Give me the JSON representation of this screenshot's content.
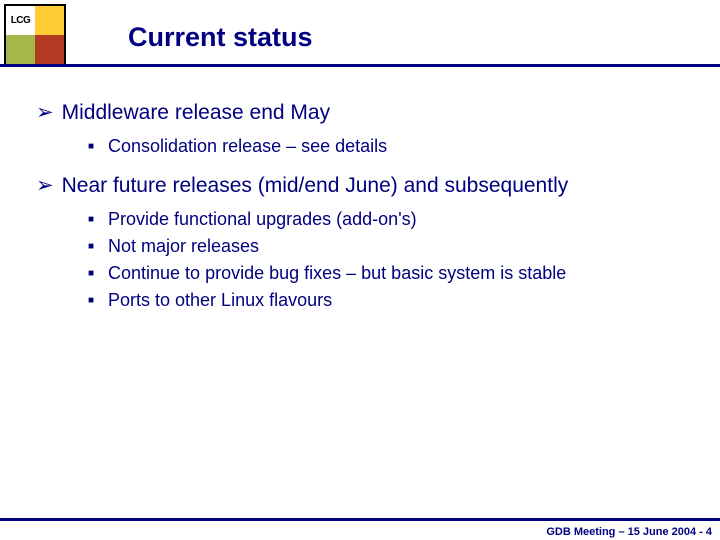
{
  "logo_text": "LCG",
  "title": "Current status",
  "bullets": [
    {
      "text": "Middleware release end May",
      "sub": [
        "Consolidation release – see details"
      ]
    },
    {
      "text": "Near future releases (mid/end June) and subsequently",
      "sub": [
        "Provide functional upgrades (add-on's)",
        "Not major releases",
        "Continue to provide bug fixes – but basic system is stable",
        "Ports to other Linux flavours"
      ]
    }
  ],
  "footer": "GDB Meeting – 15 June 2004  - 4"
}
